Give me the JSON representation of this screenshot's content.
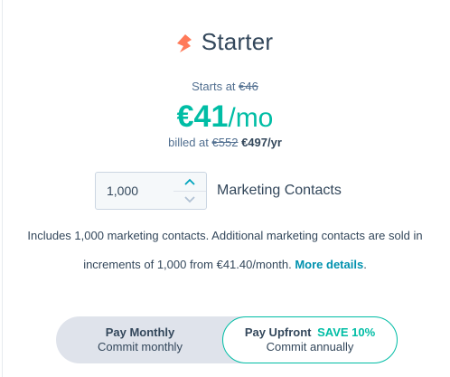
{
  "plan": {
    "name": "Starter",
    "icon": "sprocket-icon"
  },
  "pricing": {
    "starts_at_label": "Starts at",
    "original_monthly": "€46",
    "price_amount": "€41",
    "price_period": "/mo",
    "billed_label": "billed at",
    "original_yearly": "€552",
    "current_yearly": "€497/yr"
  },
  "contacts": {
    "value": "1,000",
    "label": "Marketing Contacts"
  },
  "description": {
    "text": "Includes 1,000 marketing contacts. Additional marketing contacts are sold in increments of 1,000 from €41.40/month.",
    "link": "More details",
    "suffix": "."
  },
  "billing_toggle": {
    "monthly_title": "Pay Monthly",
    "monthly_sub": "Commit monthly",
    "upfront_title": "Pay Upfront",
    "upfront_badge": "SAVE 10%",
    "upfront_sub": "Commit annually",
    "selected": "upfront"
  },
  "colors": {
    "accent": "#00bda5",
    "link": "#0091ae",
    "brand_orange": "#ff7a59",
    "text": "#33475b"
  }
}
